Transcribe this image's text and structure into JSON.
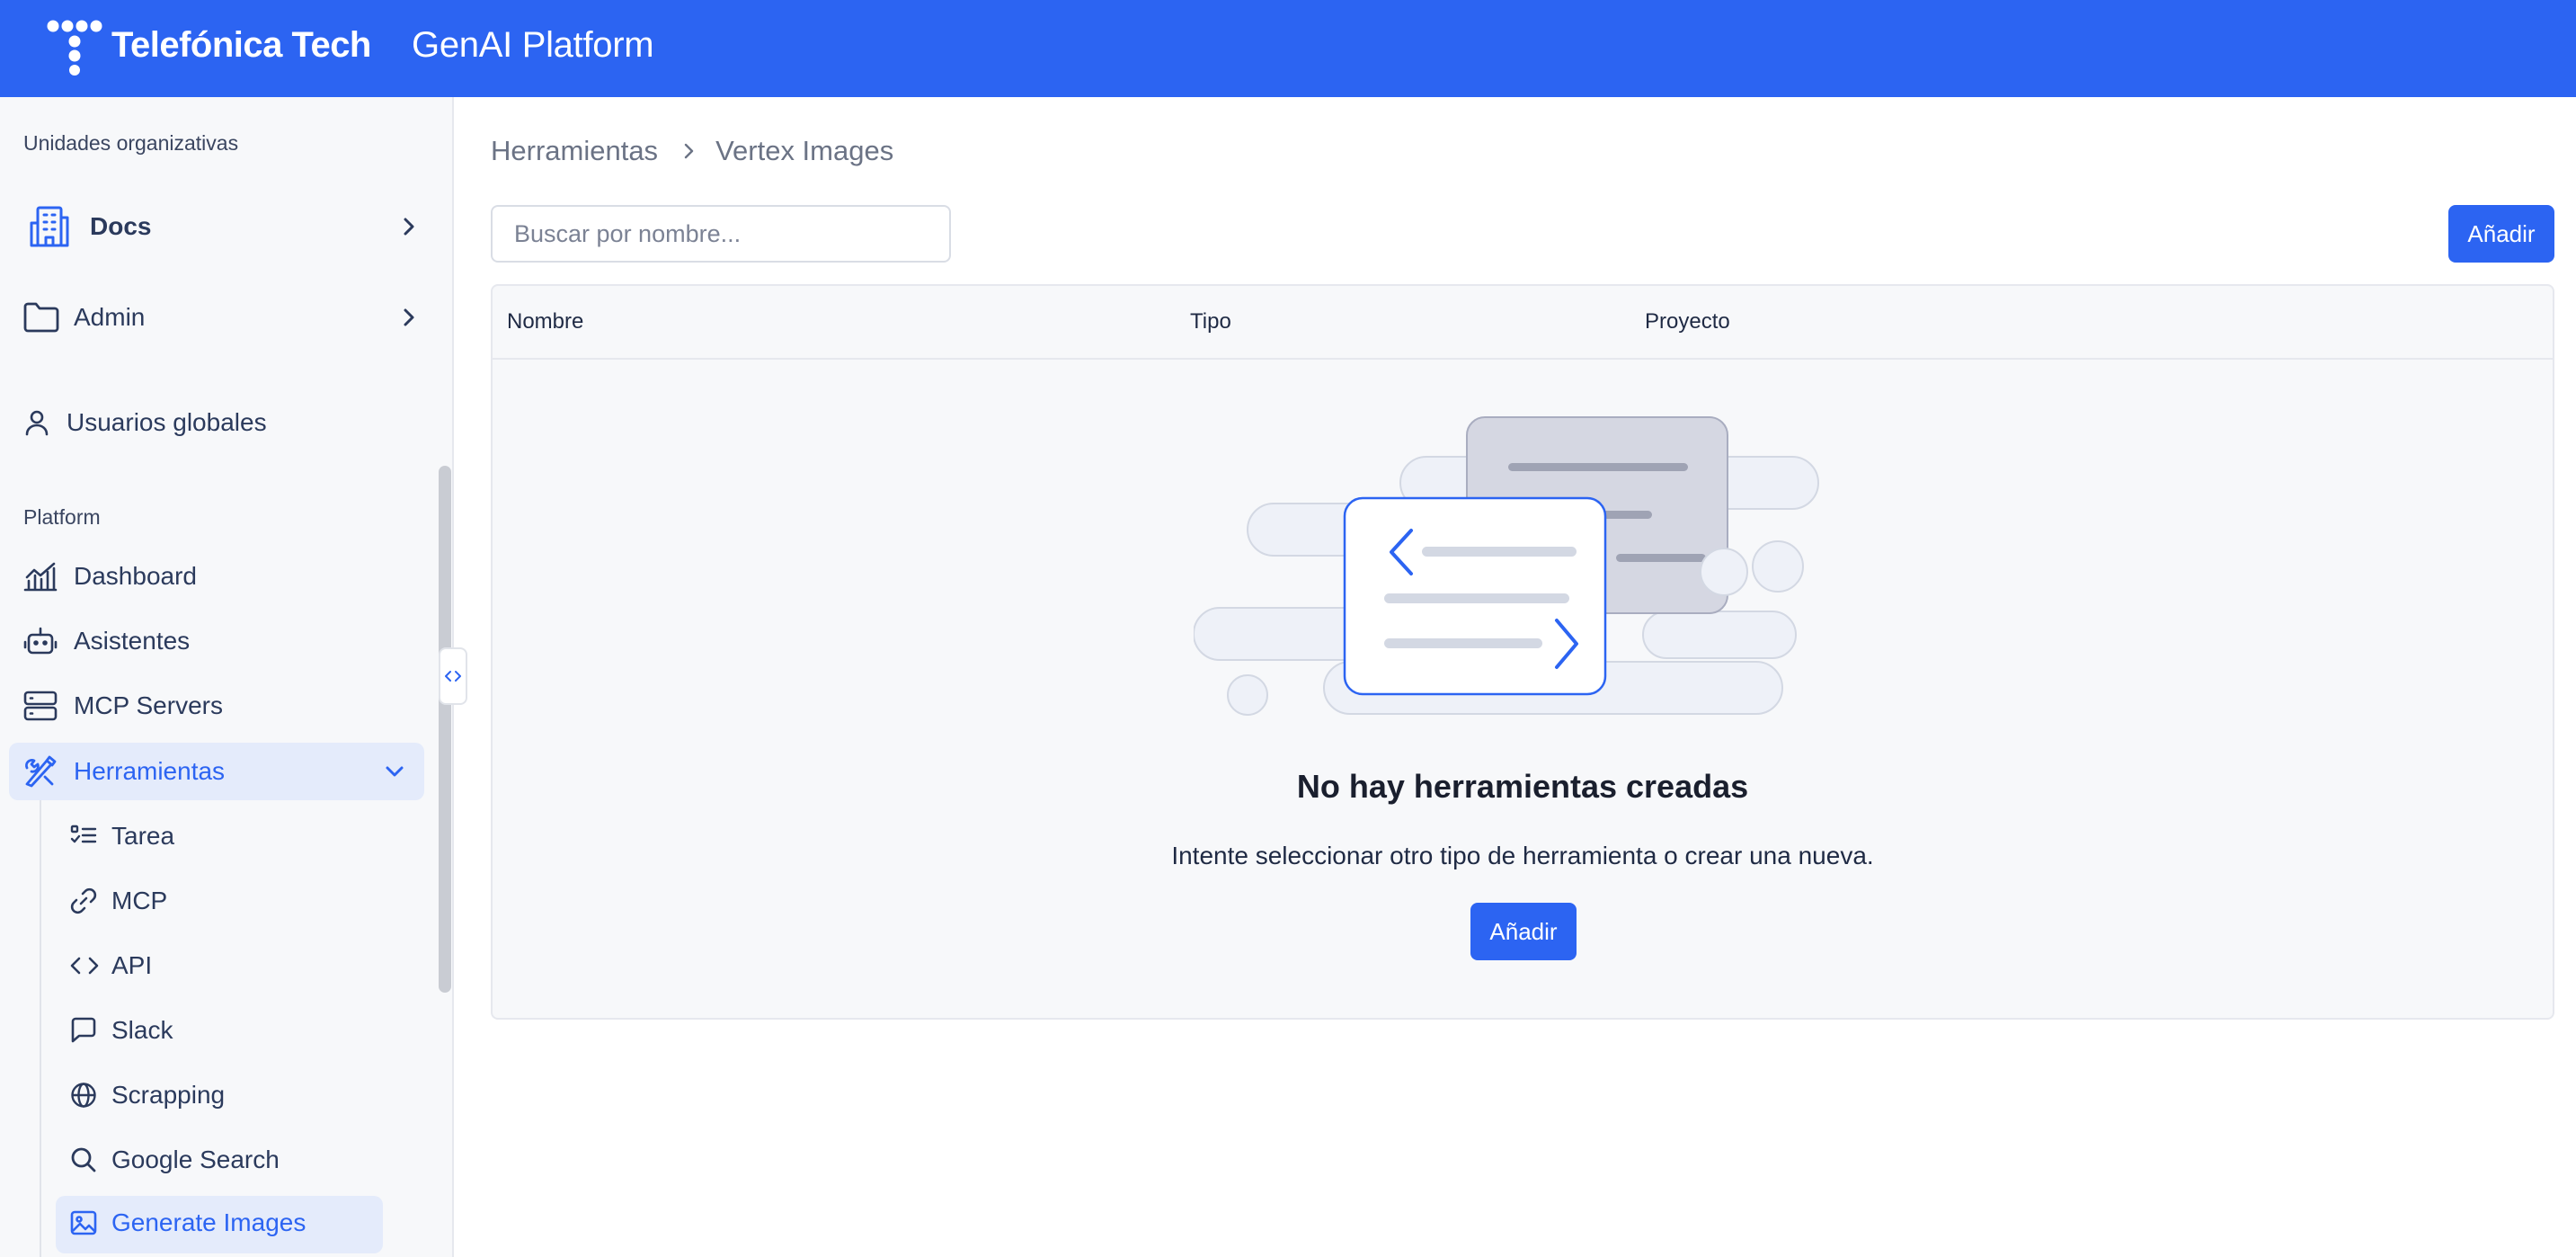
{
  "header": {
    "brand": "Telefónica Tech",
    "product": "GenAI Platform"
  },
  "sidebar": {
    "org_units_label": "Unidades organizativas",
    "org_units": [
      {
        "label": "Docs",
        "icon": "building-icon"
      },
      {
        "label": "Admin",
        "icon": "folder-icon"
      }
    ],
    "global_users": "Usuarios globales",
    "platform_label": "Platform",
    "platform_items": [
      {
        "label": "Dashboard",
        "icon": "chart-line-icon"
      },
      {
        "label": "Asistentes",
        "icon": "bot-icon"
      },
      {
        "label": "MCP Servers",
        "icon": "server-icon"
      },
      {
        "label": "Herramientas",
        "icon": "tools-icon",
        "active": true,
        "expanded": true
      }
    ],
    "tools_children": [
      {
        "label": "Tarea",
        "icon": "task-list-icon"
      },
      {
        "label": "MCP",
        "icon": "link-icon"
      },
      {
        "label": "API",
        "icon": "code-icon"
      },
      {
        "label": "Slack",
        "icon": "chat-icon"
      },
      {
        "label": "Scrapping",
        "icon": "globe-icon"
      },
      {
        "label": "Google Search",
        "icon": "search-icon"
      },
      {
        "label": "Generate Images",
        "icon": "image-icon",
        "active": true
      }
    ]
  },
  "breadcrumb": {
    "root": "Herramientas",
    "current": "Vertex Images"
  },
  "search": {
    "placeholder": "Buscar por nombre...",
    "value": ""
  },
  "actions": {
    "add_label": "Añadir"
  },
  "table": {
    "columns": [
      "Nombre",
      "Tipo",
      "Proyecto"
    ]
  },
  "empty_state": {
    "title": "No hay herramientas creadas",
    "description": "Intente seleccionar otro tipo de herramienta o crear una nueva.",
    "button_label": "Añadir"
  },
  "colors": {
    "primary": "#2c64f2",
    "sidebar_bg": "#f7f8fa",
    "active_bg": "#e4ebfb"
  }
}
